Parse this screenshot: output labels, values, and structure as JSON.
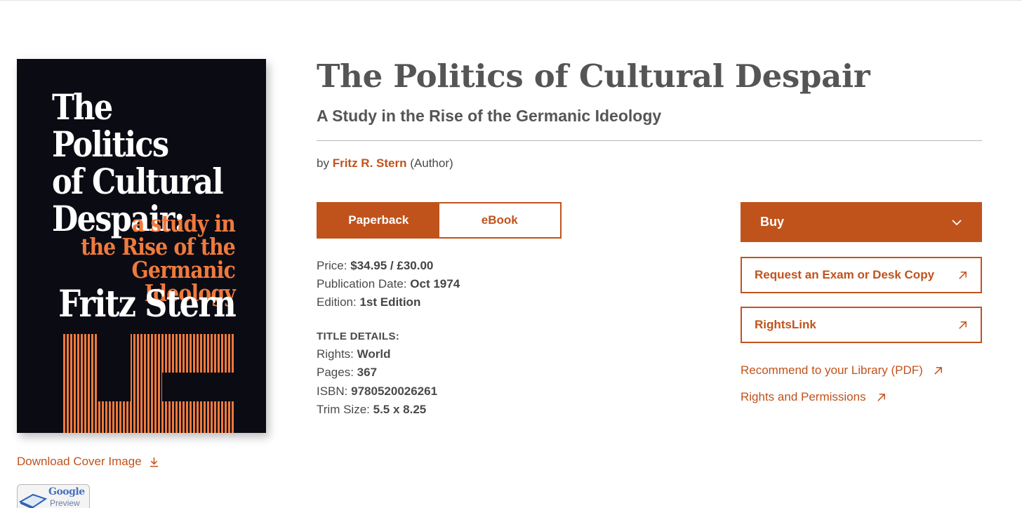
{
  "book": {
    "title": "The Politics of Cultural Despair",
    "subtitle": "A Study in the Rise of the Germanic Ideology",
    "by_prefix": "by",
    "author": "Fritz R. Stern",
    "author_role": "(Author)"
  },
  "cover": {
    "title_lines": [
      "The Politics",
      "of Cultural",
      "Despair:"
    ],
    "subtitle_lines": [
      "a study in",
      "the Rise of the",
      "Germanic Ideology"
    ],
    "author": "Fritz Stern",
    "colors": {
      "background": "#0b0b14",
      "accent": "#ef7a3c",
      "title": "#ffffff"
    }
  },
  "links": {
    "download_cover": "Download Cover Image",
    "google_preview_line1": "Google",
    "google_preview_line2": "Preview",
    "recommend": "Recommend to your Library (PDF)",
    "rights_permissions": "Rights and Permissions"
  },
  "formats": {
    "active": "Paperback",
    "inactive": "eBook"
  },
  "info": {
    "price_label": "Price:",
    "price_value": "$34.95 / £30.00",
    "pubdate_label": "Publication Date:",
    "pubdate_value": "Oct 1974",
    "edition_label": "Edition:",
    "edition_value": "1st Edition"
  },
  "details": {
    "heading": "TITLE DETAILS:",
    "rights_label": "Rights:",
    "rights_value": "World",
    "pages_label": "Pages:",
    "pages_value": "367",
    "isbn_label": "ISBN:",
    "isbn_value": "9780520026261",
    "trim_label": "Trim Size:",
    "trim_value": "5.5 x 8.25"
  },
  "actions": {
    "buy": "Buy",
    "exam_copy": "Request an Exam or Desk Copy",
    "rightslink": "RightsLink"
  },
  "icons": {
    "download": "download-icon",
    "external": "external-arrow-icon",
    "dropdown": "chevron-down-icon"
  },
  "theme": {
    "accent": "#c0531c",
    "text": "#4a4a4a"
  }
}
